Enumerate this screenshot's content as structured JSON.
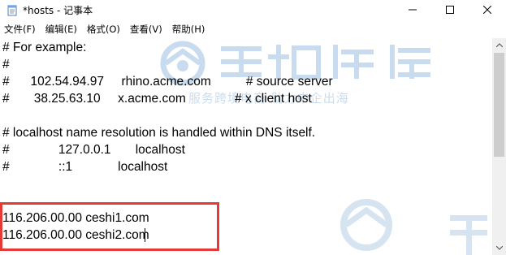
{
  "window": {
    "title": "*hosts - 记事本",
    "icon": "notepad-icon"
  },
  "menu": [
    {
      "label": "文件(F)"
    },
    {
      "label": "编辑(E)"
    },
    {
      "label": "格式(O)"
    },
    {
      "label": "查看(V)"
    },
    {
      "label": "帮助(H)"
    }
  ],
  "editor": {
    "lines": [
      "# For example:",
      "#",
      "#      102.54.94.97     rhino.acme.com          # source server",
      "#       38.25.63.10     x.acme.com              # x client host",
      "",
      "# localhost name resolution is handled within DNS itself.",
      "#              127.0.0.1       localhost",
      "#              ::1             localhost",
      "",
      "",
      "116.206.00.00 ceshi1.com",
      "116.206.00.00 ceshi2.com"
    ]
  },
  "watermark": {
    "text": "服务跨境电商 助力中企出海",
    "color": "#c9dcef"
  },
  "colors": {
    "highlight": "#e53935"
  }
}
